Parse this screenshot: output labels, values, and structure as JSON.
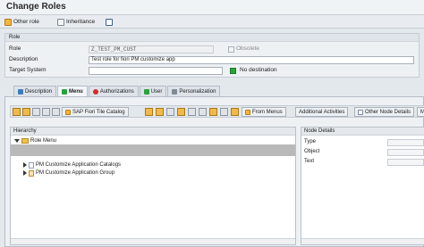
{
  "title": "Change Roles",
  "toolbar": {
    "other_role": "Other role",
    "inheritance": "Inheritance"
  },
  "role_panel": {
    "header": "Role",
    "role_label": "Role",
    "role_value": "Z_TEST_PM_CUST",
    "obsolete_label": "Obsolete",
    "description_label": "Description",
    "description_value": "Test role for fiori PM customize app",
    "target_label": "Target System",
    "target_value": "",
    "destination_status": "No destination"
  },
  "tabs": [
    {
      "label": "Description"
    },
    {
      "label": "Menu"
    },
    {
      "label": "Authorizations"
    },
    {
      "label": "User"
    },
    {
      "label": "Personalization"
    }
  ],
  "menu_toolbar": {
    "fiori_catalog": "SAP Fiori Tile Catalog",
    "from_menus": "From Menus",
    "additional_activities": "Additional Activities",
    "other_node_details": "Other Node Details",
    "more": "Me"
  },
  "hierarchy": {
    "header": "Hierarchy",
    "root": "Role Menu",
    "items": [
      "PM Customize Application Catalogs",
      "PM Customize Application Group"
    ]
  },
  "node_details": {
    "header": "Node Details",
    "fields": [
      "Type",
      "Object",
      "Text"
    ]
  },
  "colors": {
    "status_green": "#27a33a",
    "selection_gray": "#b9b9b9"
  }
}
